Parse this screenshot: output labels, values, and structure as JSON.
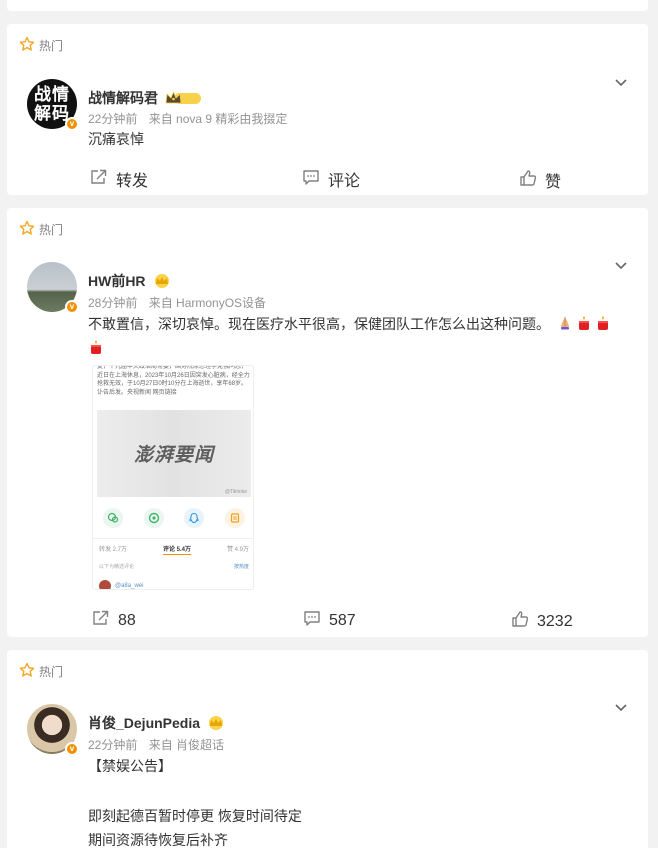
{
  "hot_label": "热门",
  "posts": [
    {
      "author": "战情解码君",
      "avatar_text": "战情解码",
      "level_badge": "1",
      "time": "22分钟前",
      "source": "来自 nova 9 精彩由我掇定",
      "text": "沉痛哀悼",
      "actions": {
        "repost": "转发",
        "comment": "评论",
        "like": "赞"
      }
    },
    {
      "author": "HW前HR",
      "time": "28分钟前",
      "source": "来自 HarmonyOS设备",
      "text": "不敢置信，深切哀悼。现在医疗水平很高，保健团队工作怎么出这种问题。",
      "actions": {
        "repost": "88",
        "comment": "587",
        "like": "3232"
      },
      "screenshot": {
        "news_text": "复，十九届中央政治局常委，国务院原总理李克强同志，近日在上海休息，2023年10月26日因突发心脏病，经全力抢救无效，于10月27日0时10分在上海逝世，享年68岁。讣告后发。央视新闻 网页链接",
        "banner": "澎湃要闻",
        "watermark": "@Tikitoke",
        "stats": {
          "repost": "转发 2.7万",
          "comment": "评论 5.4万",
          "like": "赞 4.9万"
        },
        "sort_label": "以下为精选评论",
        "sort_toggle": "按热度",
        "commenter": "@a8a_wei"
      }
    },
    {
      "author": "肖俊_DejunPedia",
      "time": "22分钟前",
      "source": "来自 肖俊超话",
      "lines": [
        "【禁娱公告】",
        "",
        "即刻起德百暂时停更 恢复时间待定",
        "期间资源待恢复后补齐"
      ]
    }
  ],
  "colors": {
    "accent_orange": "#f29100",
    "meta_gray": "#939393",
    "star": "#f5a623"
  }
}
